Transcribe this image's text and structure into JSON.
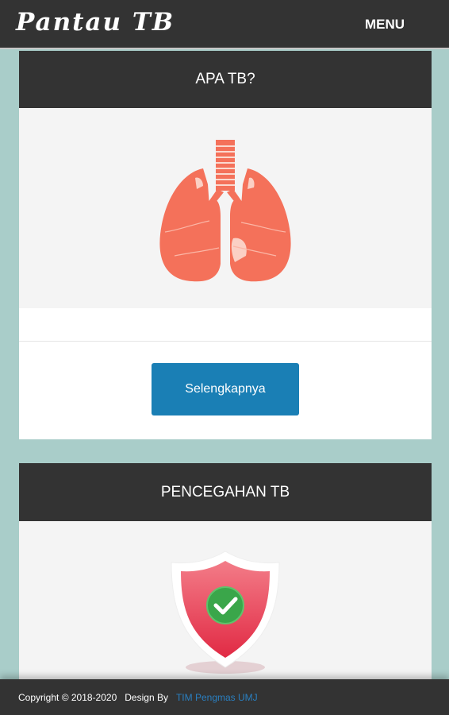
{
  "navbar": {
    "brand": "Pantau TB",
    "menu_label": "MENU"
  },
  "cards": [
    {
      "title": "APA TB?",
      "image_icon": "lungs-icon",
      "button_label": "Selengkapnya"
    },
    {
      "title": "PENCEGAHAN TB",
      "image_icon": "shield-check-icon"
    }
  ],
  "footer": {
    "copyright": "Copyright © 2018-2020",
    "design_by": "Design By",
    "link_text": "TIM Pengmas UMJ"
  },
  "colors": {
    "navbar_bg": "#333333",
    "page_bg": "#a9cdc9",
    "button_bg": "#1a7fb5",
    "link": "#2a7fc0",
    "lungs": "#f4715a",
    "shield": "#e9374b",
    "check": "#3aa64a"
  }
}
